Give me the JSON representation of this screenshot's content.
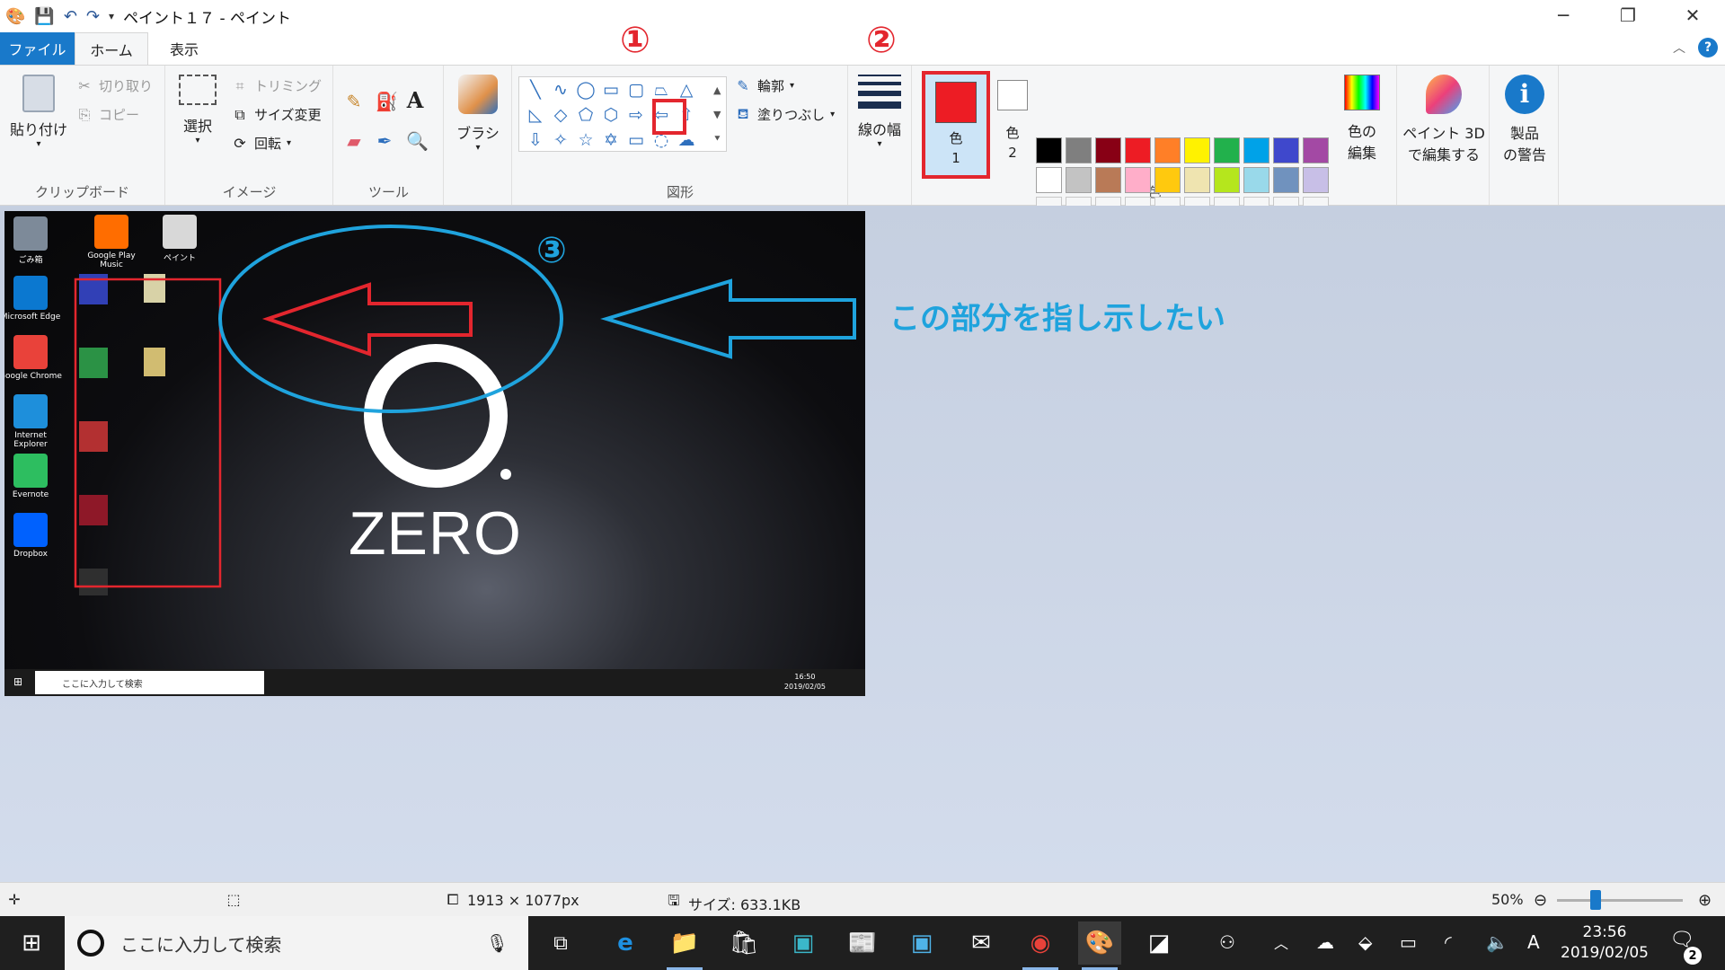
{
  "titlebar": {
    "title": "ペイント１７ - ペイント",
    "quick_access": [
      "save-icon",
      "undo-icon",
      "redo-icon",
      "customize-icon"
    ]
  },
  "tabs": {
    "file": "ファイル",
    "home": "ホーム",
    "view": "表示"
  },
  "ribbon": {
    "clipboard": {
      "paste": "貼り付け",
      "cut": "切り取り",
      "copy": "コピー",
      "label": "クリップボード"
    },
    "image": {
      "select": "選択",
      "crop": "トリミング",
      "resize": "サイズ変更",
      "rotate": "回転",
      "label": "イメージ"
    },
    "tools": {
      "label": "ツール",
      "text_tool": "A"
    },
    "brushes": {
      "label": "ブラシ"
    },
    "shapes": {
      "outline": "輪郭",
      "fill": "塗りつぶし",
      "label": "図形"
    },
    "size": {
      "label": "線の幅"
    },
    "colors": {
      "color1_line1": "色",
      "color1_line2": "1",
      "color2_line1": "色",
      "color2_line2": "2",
      "color1_hex": "#ed1c24",
      "color2_hex": "#ffffff",
      "edit_line1": "色の",
      "edit_line2": "編集",
      "label": "色",
      "palette": [
        "#000000",
        "#7f7f7f",
        "#880015",
        "#ed1c24",
        "#ff7f27",
        "#fff200",
        "#22b14c",
        "#00a2e8",
        "#3f48cc",
        "#a349a4",
        "#ffffff",
        "#c3c3c3",
        "#b97a57",
        "#ffaec9",
        "#ffc90e",
        "#efe4b0",
        "#b5e61d",
        "#99d9ea",
        "#7092be",
        "#c8bfe7"
      ]
    },
    "paint3d": {
      "line1": "ペイント 3D",
      "line2": "で編集する"
    },
    "product_alert": {
      "line1": "製品",
      "line2": "の警告"
    }
  },
  "annotations": {
    "num1": "①",
    "num2": "②",
    "num3": "③",
    "callout": "この部分を指し示したい"
  },
  "canvas": {
    "icons_left": [
      {
        "label": "ごみ箱",
        "color": "#7d8a99"
      },
      {
        "label": "Microsoft Edge",
        "color": "#0b78d0"
      },
      {
        "label": "Google Chrome",
        "color": "#e9423a"
      },
      {
        "label": "Internet Explorer",
        "color": "#1e8fdb"
      },
      {
        "label": "Evernote",
        "color": "#2dbe60"
      },
      {
        "label": "Dropbox",
        "color": "#0061fe"
      }
    ],
    "icons_top": [
      {
        "label": "Google Play Music",
        "color": "#ff6d00"
      },
      {
        "label": "ペイント",
        "color": "#d8d8d8"
      }
    ],
    "logo_text": "ZERO",
    "mini_search": "ここに入力して検索",
    "mini_time": "16:50",
    "mini_date": "2019/02/05"
  },
  "status": {
    "dimensions": "1913 × 1077px",
    "size": "サイズ: 633.1KB",
    "zoom": "50%",
    "zoom_fraction": 0.5
  },
  "taskbar": {
    "search": "ここに入力して検索",
    "time": "23:56",
    "date": "2019/02/05",
    "notifications": "2",
    "ime": "A"
  }
}
